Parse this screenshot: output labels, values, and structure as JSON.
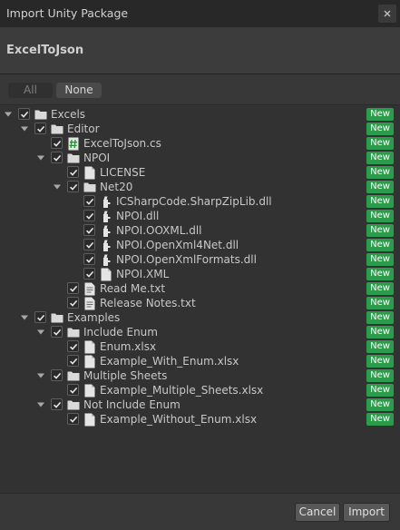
{
  "window": {
    "title": "Import Unity Package"
  },
  "package": {
    "name": "ExcelToJson"
  },
  "toolbar": {
    "all_label": "All",
    "none_label": "None"
  },
  "badge_label": "New",
  "colors": {
    "badge": "#2a9c4b",
    "background": "#383838",
    "tree_bg": "#323232"
  },
  "tree": [
    {
      "label": "Excels",
      "depth": 0,
      "type": "folder",
      "expanded": true,
      "checked": true,
      "new": true
    },
    {
      "label": "Editor",
      "depth": 1,
      "type": "folder",
      "expanded": true,
      "checked": true,
      "new": true
    },
    {
      "label": "ExcelToJson.cs",
      "depth": 2,
      "type": "script",
      "checked": true,
      "new": true
    },
    {
      "label": "NPOI",
      "depth": 2,
      "type": "folder",
      "expanded": true,
      "checked": true,
      "new": true
    },
    {
      "label": "LICENSE",
      "depth": 3,
      "type": "file",
      "checked": true,
      "new": true
    },
    {
      "label": "Net20",
      "depth": 3,
      "type": "folder",
      "expanded": true,
      "checked": true,
      "new": true
    },
    {
      "label": "ICSharpCode.SharpZipLib.dll",
      "depth": 4,
      "type": "dll",
      "checked": true,
      "new": true
    },
    {
      "label": "NPOI.dll",
      "depth": 4,
      "type": "dll",
      "checked": true,
      "new": true
    },
    {
      "label": "NPOI.OOXML.dll",
      "depth": 4,
      "type": "dll",
      "checked": true,
      "new": true
    },
    {
      "label": "NPOI.OpenXml4Net.dll",
      "depth": 4,
      "type": "dll",
      "checked": true,
      "new": true
    },
    {
      "label": "NPOI.OpenXmlFormats.dll",
      "depth": 4,
      "type": "dll",
      "checked": true,
      "new": true
    },
    {
      "label": "NPOI.XML",
      "depth": 4,
      "type": "file",
      "checked": true,
      "new": true
    },
    {
      "label": "Read Me.txt",
      "depth": 3,
      "type": "text",
      "checked": true,
      "new": true
    },
    {
      "label": "Release Notes.txt",
      "depth": 3,
      "type": "text",
      "checked": true,
      "new": true
    },
    {
      "label": "Examples",
      "depth": 1,
      "type": "folder",
      "expanded": true,
      "checked": true,
      "new": true
    },
    {
      "label": "Include Enum",
      "depth": 2,
      "type": "folder",
      "expanded": true,
      "checked": true,
      "new": true
    },
    {
      "label": "Enum.xlsx",
      "depth": 3,
      "type": "file",
      "checked": true,
      "new": true
    },
    {
      "label": "Example_With_Enum.xlsx",
      "depth": 3,
      "type": "file",
      "checked": true,
      "new": true
    },
    {
      "label": "Multiple Sheets",
      "depth": 2,
      "type": "folder",
      "expanded": true,
      "checked": true,
      "new": true
    },
    {
      "label": "Example_Multiple_Sheets.xlsx",
      "depth": 3,
      "type": "file",
      "checked": true,
      "new": true
    },
    {
      "label": "Not Include Enum",
      "depth": 2,
      "type": "folder",
      "expanded": true,
      "checked": true,
      "new": true
    },
    {
      "label": "Example_Without_Enum.xlsx",
      "depth": 3,
      "type": "file",
      "checked": true,
      "new": true
    }
  ],
  "footer": {
    "cancel_label": "Cancel",
    "import_label": "Import"
  }
}
